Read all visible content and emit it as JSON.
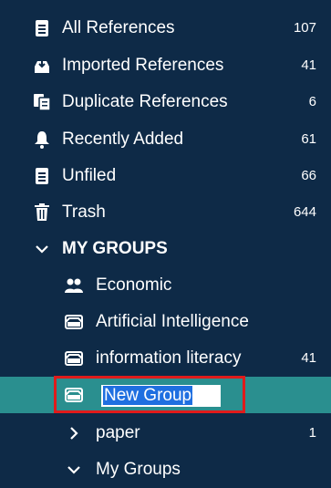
{
  "library": {
    "items": [
      {
        "label": "All References",
        "count": "107",
        "icon": "document-icon"
      },
      {
        "label": "Imported References",
        "count": "41",
        "icon": "import-icon"
      },
      {
        "label": "Duplicate References",
        "count": "6",
        "icon": "duplicate-icon"
      },
      {
        "label": "Recently Added",
        "count": "61",
        "icon": "bell-icon"
      },
      {
        "label": "Unfiled",
        "count": "66",
        "icon": "unfiled-icon"
      },
      {
        "label": "Trash",
        "count": "644",
        "icon": "trash-icon"
      }
    ]
  },
  "my_groups": {
    "header": "MY GROUPS",
    "groups": [
      {
        "label": "Economic",
        "count": "",
        "icon": "people-icon"
      },
      {
        "label": "Artificial Intelligence",
        "count": "",
        "icon": "group-icon"
      },
      {
        "label": "information literacy",
        "count": "41",
        "icon": "group-icon"
      }
    ],
    "new_group": {
      "value": "New Group"
    },
    "sets": [
      {
        "label": "paper",
        "count": "1",
        "icon": "chevron-right-icon"
      },
      {
        "label": "My Groups",
        "count": "",
        "icon": "chevron-down-icon"
      }
    ]
  },
  "colors": {
    "background": "#0e2a47",
    "selected": "#2a8f8f",
    "highlight_border": "#e01b1b",
    "text_selection": "#1f6fe0"
  }
}
